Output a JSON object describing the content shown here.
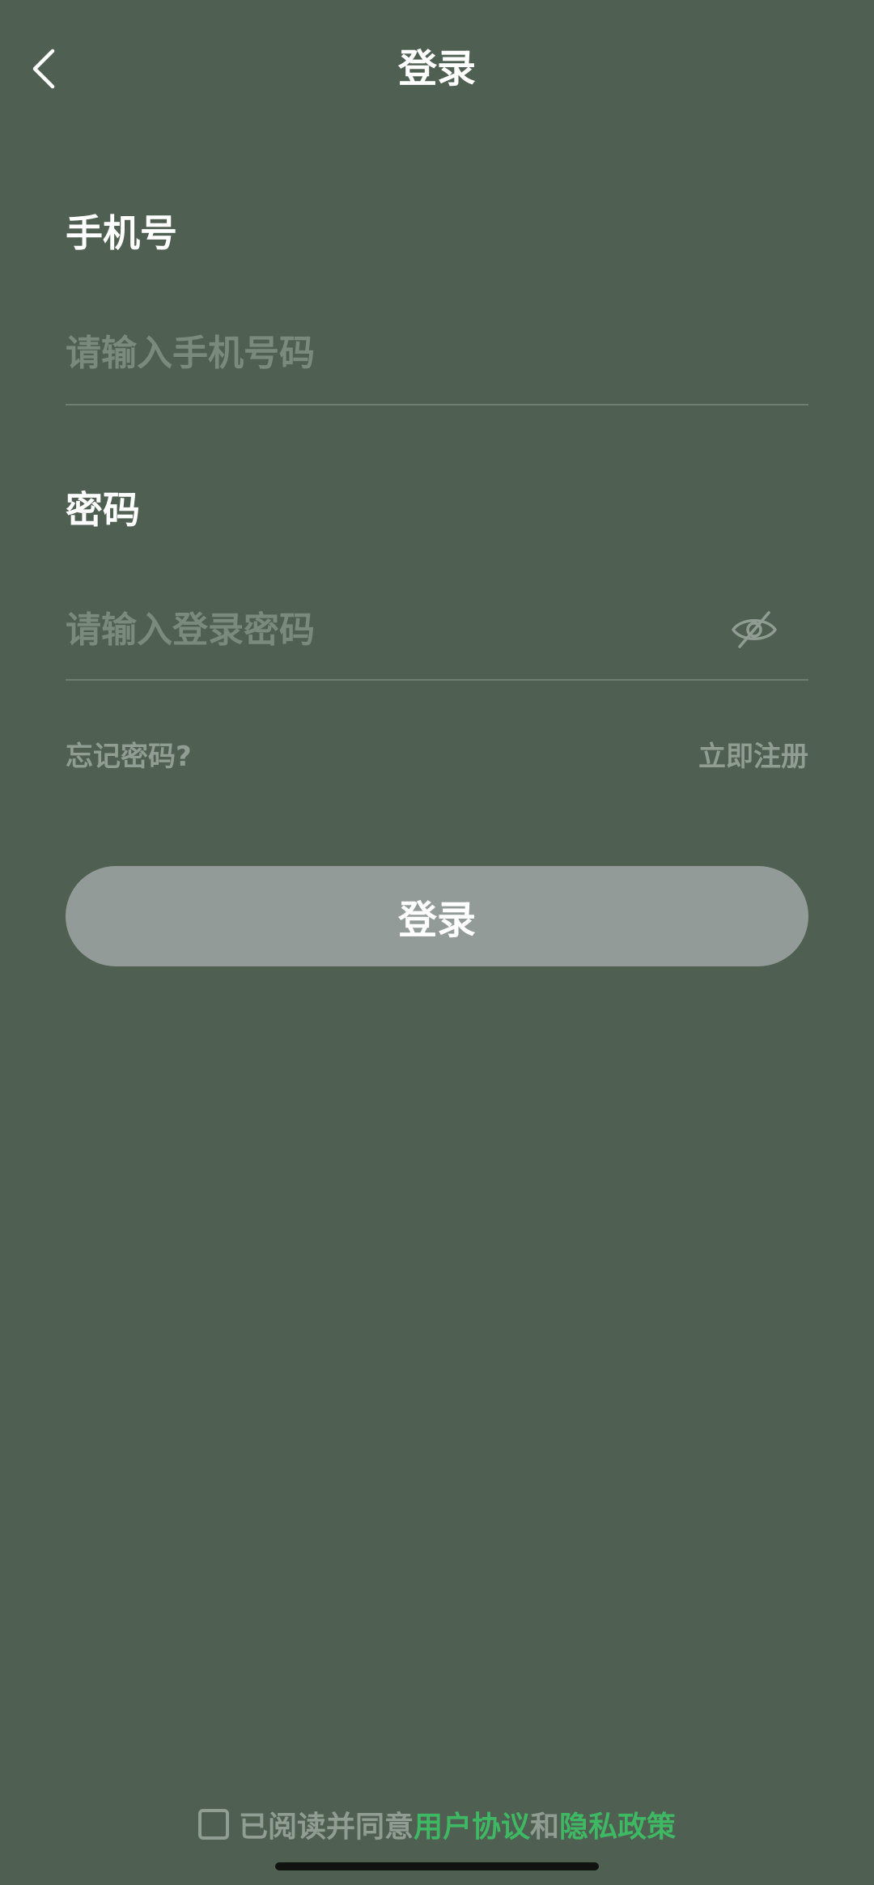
{
  "header": {
    "title": "登录",
    "back_icon": "chevron-left-icon"
  },
  "phone_field": {
    "label": "手机号",
    "placeholder": "请输入手机号码",
    "value": ""
  },
  "password_field": {
    "label": "密码",
    "placeholder": "请输入登录密码",
    "value": "",
    "toggle_icon": "eye-slash-icon"
  },
  "links": {
    "forgot_password": "忘记密码?",
    "register": "立即注册"
  },
  "login_button": {
    "label": "登录"
  },
  "agreement": {
    "checked": false,
    "prefix": "已阅读并同意",
    "user_agreement": "用户协议",
    "conjunction": "和",
    "privacy_policy": "隐私政策"
  },
  "colors": {
    "background": "#4f6052",
    "button": "#929b98",
    "link_accent": "#3fb864",
    "muted_text": "#8f9d92"
  }
}
